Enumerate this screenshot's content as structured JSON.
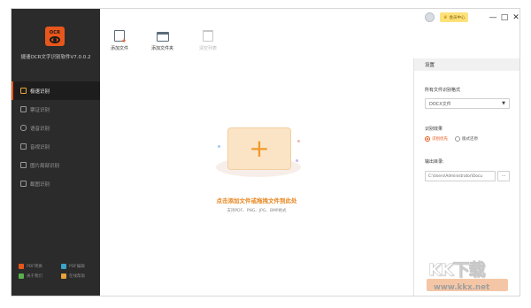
{
  "app": {
    "name": "捷速OCR文字识别软件V7.0.0.2",
    "logo_text": "OCR"
  },
  "sidebar": {
    "items": [
      {
        "label": "极速识别",
        "icon": "recognize-icon",
        "active": true
      },
      {
        "label": "票证识别",
        "icon": "ticket-icon",
        "active": false
      },
      {
        "label": "语音识别",
        "icon": "microphone-icon",
        "active": false
      },
      {
        "label": "音视识别",
        "icon": "video-icon",
        "active": false
      },
      {
        "label": "图片局部识别",
        "icon": "image-crop-icon",
        "active": false
      },
      {
        "label": "截图识别",
        "icon": "screenshot-icon",
        "active": false
      }
    ],
    "tools": [
      {
        "label": "PDF转换",
        "icon": "pdf-convert-icon",
        "color": "#e8561b"
      },
      {
        "label": "PDF编辑",
        "icon": "pdf-edit-icon",
        "color": "#3aa3c7"
      },
      {
        "label": "关于我们",
        "icon": "about-icon",
        "color": "#58b04c"
      },
      {
        "label": "在线帮助",
        "icon": "help-icon",
        "color": "#e8a33a"
      }
    ]
  },
  "titlebar": {
    "vip_label": "会员中心",
    "minimize": "—",
    "maximize": "□",
    "close": "✕"
  },
  "toolbar": {
    "add_file": "添加文件",
    "add_folder": "添加文件夹",
    "clear_list": "清空列表"
  },
  "dropzone": {
    "title": "点击添加文件或拖拽文件到此处",
    "formats": "支持PDF、PNG、JPG、BMP格式"
  },
  "settings": {
    "header": "设置",
    "format_label": "所有文件识别格式",
    "format_value": "DOCX文件",
    "effect_label": "识别效果",
    "effect_options": [
      "识别优先",
      "版式还原"
    ],
    "effect_selected": 0,
    "output_label": "输出目录:",
    "output_path": "C:\\Users\\Administrator\\Docu",
    "browse_label": "···"
  },
  "watermark": {
    "main": "KK下载",
    "url": "www.kkx.net"
  },
  "colors": {
    "accent": "#e8561b",
    "sidebar_bg": "#2b2b2b",
    "drop_text": "#e8851f"
  }
}
